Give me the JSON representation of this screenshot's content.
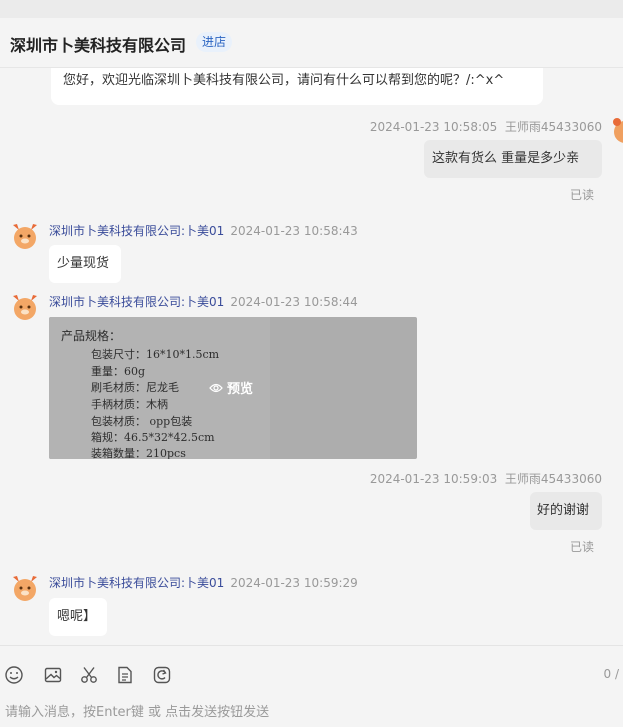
{
  "header": {
    "title": "深圳市卜美科技有限公司",
    "store_label": "进店"
  },
  "messages": {
    "welcome": "您好，欢迎光临深圳卜美科技有限公司，请问有什么可以帮到您的呢？/:^x^",
    "m1": {
      "time": "2024-01-23 10:58:05",
      "sender": "王师雨45433060",
      "text": "这款有货么  重量是多少亲",
      "status": "已读"
    },
    "m2": {
      "sender": "深圳市卜美科技有限公司:卜美01",
      "time": "2024-01-23 10:58:43",
      "text": "少量现货"
    },
    "m3": {
      "sender": "深圳市卜美科技有限公司:卜美01",
      "time": "2024-01-23 10:58:44",
      "image": {
        "title": "产品规格：",
        "lines": [
          "包装尺寸：16*10*1.5cm",
          "重量：60g",
          "刷毛材质：尼龙毛",
          "手柄材质：木柄",
          "包装材质：  opp包装",
          "箱规：46.5*32*42.5cm",
          "装箱数量：210pcs"
        ],
        "preview_label": "预览"
      }
    },
    "m4": {
      "time": "2024-01-23 10:59:03",
      "sender": "王师雨45433060",
      "text": "好的谢谢",
      "status": "已读"
    },
    "m5": {
      "sender": "深圳市卜美科技有限公司:卜美01",
      "time": "2024-01-23 10:59:29",
      "text": "嗯呢】"
    }
  },
  "composer": {
    "placeholder": "请输入消息，按Enter键 或 点击发送按钮发送",
    "counter": "0 /",
    "tools": [
      "emoji-icon",
      "image-icon",
      "scissors-icon",
      "document-icon",
      "refresh-icon"
    ]
  }
}
